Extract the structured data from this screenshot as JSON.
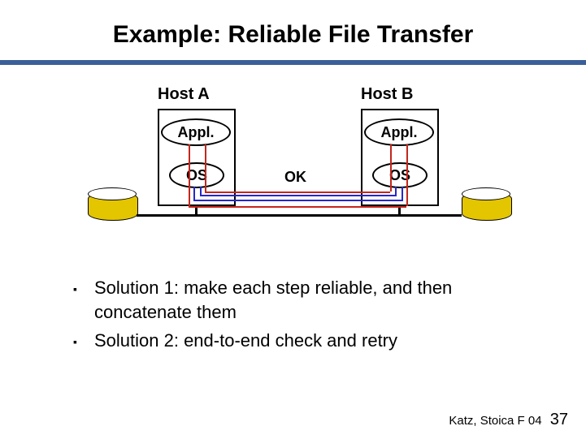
{
  "title": "Example: Reliable File Transfer",
  "hosts": {
    "a": {
      "label": "Host A",
      "app": "Appl.",
      "os": "OS"
    },
    "b": {
      "label": "Host B",
      "app": "Appl.",
      "os": "OS"
    }
  },
  "link_label": "OK",
  "bullets": [
    "Solution 1: make each step reliable, and then concatenate them",
    "Solution 2: end-to-end check and retry"
  ],
  "footer": {
    "credit": "Katz, Stoica F 04",
    "page": "37"
  }
}
